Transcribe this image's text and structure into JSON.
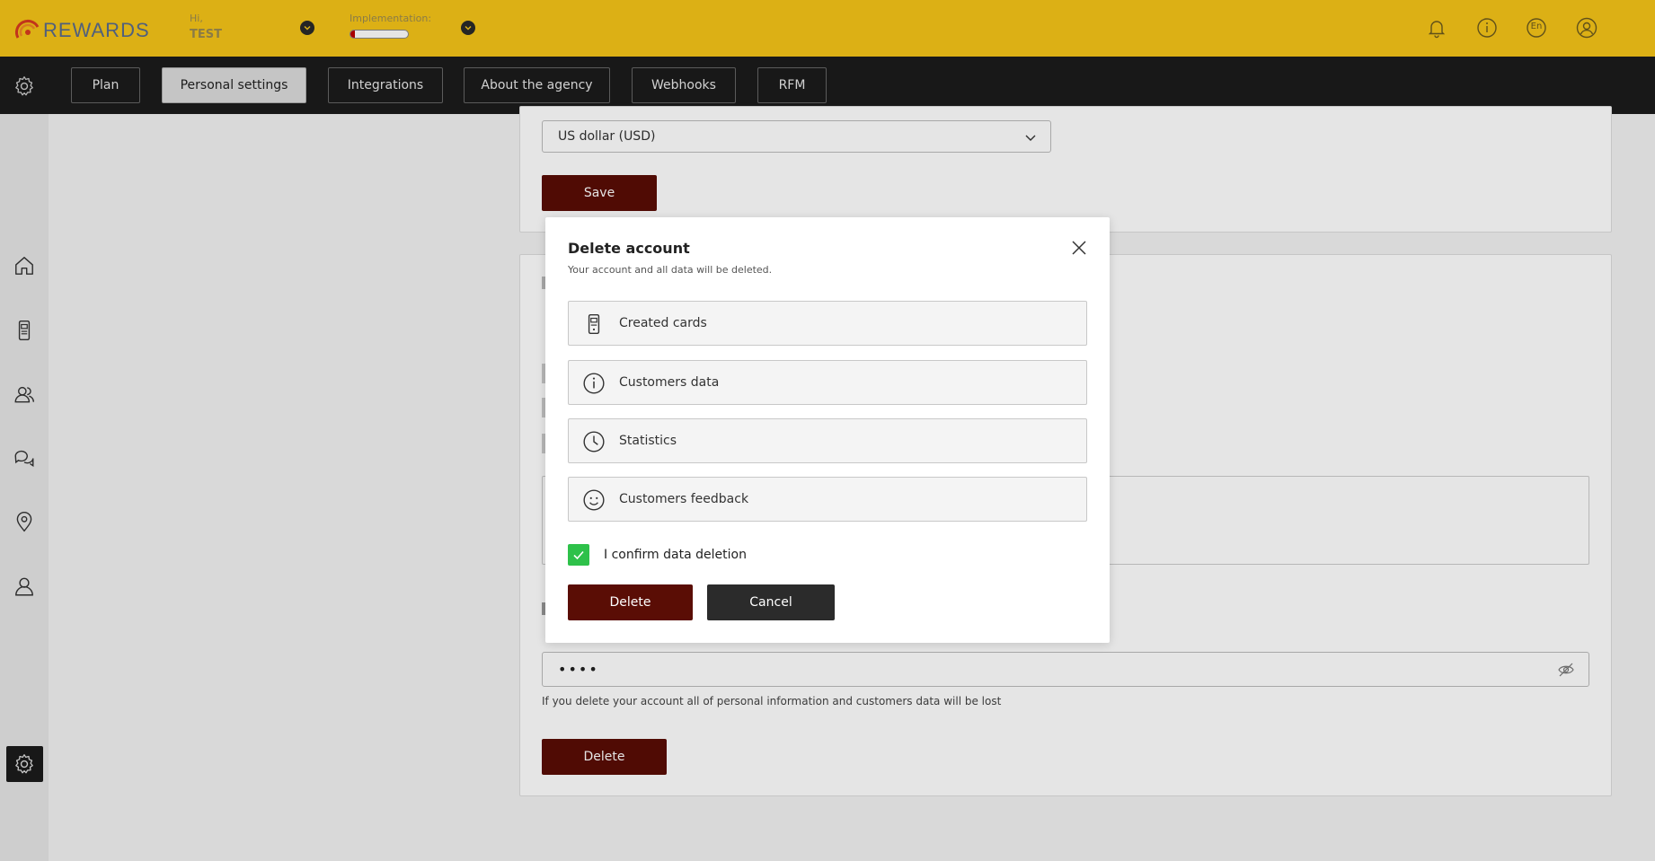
{
  "header": {
    "logo_text": "REWARDS",
    "greeting": "Hi,",
    "user_name": "TEST",
    "implementation_label": "Implementation:",
    "implementation_progress": 0.08,
    "language": "En"
  },
  "tabs": [
    {
      "label": "Plan"
    },
    {
      "label": "Personal settings",
      "active": true
    },
    {
      "label": "Integrations"
    },
    {
      "label": "About the agency"
    },
    {
      "label": "Webhooks"
    },
    {
      "label": "RFM"
    }
  ],
  "sidebar": {
    "items": [
      "home-icon",
      "card-icon",
      "customers-icon",
      "chat-icon",
      "location-icon",
      "user-icon",
      "settings-icon"
    ],
    "active": "settings-icon"
  },
  "settings": {
    "currency_value": "US dollar (USD)",
    "save_label": "Save",
    "password_value": "••••",
    "delete_hint": "If you delete your account all of personal information and customers data will be lost",
    "delete_label": "Delete"
  },
  "modal": {
    "title": "Delete account",
    "subtitle": "Your account and all data will be deleted.",
    "items": [
      {
        "label": "Created cards",
        "icon": "card-icon"
      },
      {
        "label": "Customers data",
        "icon": "info-icon"
      },
      {
        "label": "Statistics",
        "icon": "clock-icon"
      },
      {
        "label": "Customers feedback",
        "icon": "smiley-icon"
      }
    ],
    "confirm_label": "I confirm data deletion",
    "confirm_checked": true,
    "delete_button": "Delete",
    "cancel_button": "Cancel"
  },
  "colors": {
    "header_bg": "#f5c518",
    "nav_bg": "#1b1b1b",
    "primary_dark": "#5a0d05",
    "checkbox_green": "#2ec14a"
  }
}
